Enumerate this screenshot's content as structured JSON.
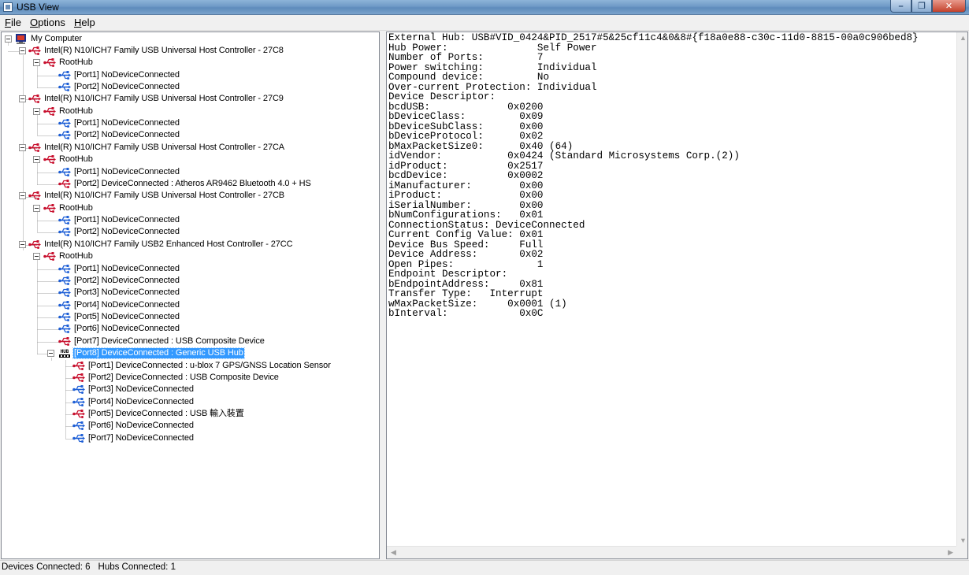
{
  "window": {
    "title": "USB View"
  },
  "menu": {
    "file": "File",
    "options": "Options",
    "help": "Help"
  },
  "tree": {
    "root": "My Computer",
    "controller_1": "Intel(R) N10/ICH7 Family USB Universal Host Controller - 27C8",
    "controller_2": "Intel(R) N10/ICH7 Family USB Universal Host Controller - 27C9",
    "controller_3": "Intel(R) N10/ICH7 Family USB Universal Host Controller - 27CA",
    "controller_4": "Intel(R) N10/ICH7 Family USB Universal Host Controller - 27CB",
    "controller_5": "Intel(R) N10/ICH7 Family USB2 Enhanced Host Controller - 27CC",
    "roothub": "RootHub",
    "c1_port1": "[Port1] NoDeviceConnected",
    "c1_port2": "[Port2] NoDeviceConnected",
    "c2_port1": "[Port1] NoDeviceConnected",
    "c2_port2": "[Port2] NoDeviceConnected",
    "c3_port1": "[Port1] NoDeviceConnected",
    "c3_port2": "[Port2] DeviceConnected :  Atheros AR9462 Bluetooth 4.0 + HS",
    "c4_port1": "[Port1] NoDeviceConnected",
    "c4_port2": "[Port2] NoDeviceConnected",
    "c5_port1": "[Port1] NoDeviceConnected",
    "c5_port2": "[Port2] NoDeviceConnected",
    "c5_port3": "[Port3] NoDeviceConnected",
    "c5_port4": "[Port4] NoDeviceConnected",
    "c5_port5": "[Port5] NoDeviceConnected",
    "c5_port6": "[Port6] NoDeviceConnected",
    "c5_port7": "[Port7] DeviceConnected :  USB Composite Device",
    "c5_port8": "[Port8] DeviceConnected :  Generic USB Hub",
    "hub_port1": "[Port1] DeviceConnected :  u-blox 7 GPS/GNSS Location Sensor",
    "hub_port2": "[Port2] DeviceConnected :  USB Composite Device",
    "hub_port3": "[Port3] NoDeviceConnected",
    "hub_port4": "[Port4] NoDeviceConnected",
    "hub_port5": "[Port5] DeviceConnected :  USB 輸入裝置",
    "hub_port6": "[Port6] NoDeviceConnected",
    "hub_port7": "[Port7] NoDeviceConnected",
    "hub_icon_text": "HUB"
  },
  "detail": {
    "line_01": "External Hub: USB#VID_0424&PID_2517#5&25cf11c4&0&8#{f18a0e88-c30c-11d0-8815-00a0c906bed8}",
    "line_02": "Hub Power:               Self Power",
    "line_03": "Number of Ports:         7",
    "line_04": "Power switching:         Individual",
    "line_05": "Compound device:         No",
    "line_06": "Over-current Protection: Individual",
    "line_07": "",
    "line_08": "Device Descriptor:",
    "line_09": "bcdUSB:             0x0200",
    "line_10": "bDeviceClass:         0x09",
    "line_11": "bDeviceSubClass:      0x00",
    "line_12": "bDeviceProtocol:      0x02",
    "line_13": "bMaxPacketSize0:      0x40 (64)",
    "line_14": "idVendor:           0x0424 (Standard Microsystems Corp.(2))",
    "line_15": "idProduct:          0x2517",
    "line_16": "bcdDevice:          0x0002",
    "line_17": "iManufacturer:        0x00",
    "line_18": "iProduct:             0x00",
    "line_19": "iSerialNumber:        0x00",
    "line_20": "bNumConfigurations:   0x01",
    "line_21": "",
    "line_22": "ConnectionStatus: DeviceConnected",
    "line_23": "Current Config Value: 0x01",
    "line_24": "Device Bus Speed:     Full",
    "line_25": "Device Address:       0x02",
    "line_26": "Open Pipes:              1",
    "line_27": "",
    "line_28": "Endpoint Descriptor:",
    "line_29": "bEndpointAddress:     0x81",
    "line_30": "Transfer Type:   Interrupt",
    "line_31": "wMaxPacketSize:     0x0001 (1)",
    "line_32": "bInterval:            0x0C"
  },
  "status": {
    "devices": "Devices Connected: 6",
    "hubs": "Hubs Connected: 1"
  },
  "colors": {
    "selection": "#3399ff",
    "usb_connected_icon": "#c8102e",
    "usb_empty_icon": "#1e5fd6"
  }
}
